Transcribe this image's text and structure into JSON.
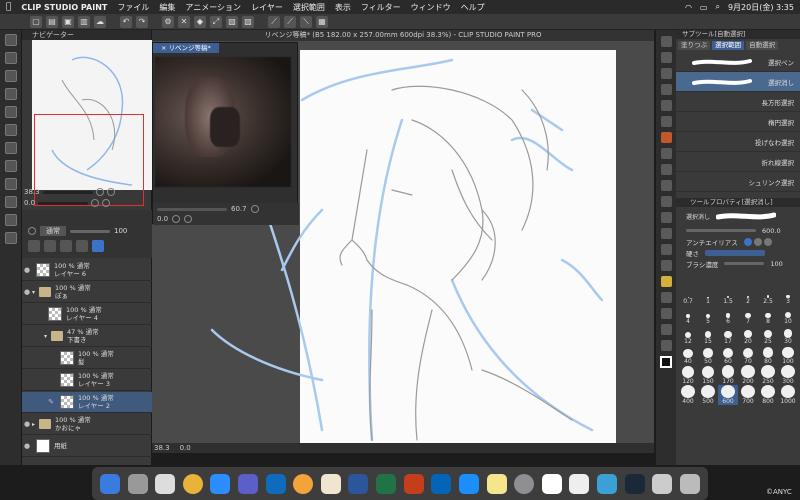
{
  "menubar": {
    "app_name": "CLIP STUDIO PAINT",
    "menus": [
      "ファイル",
      "編集",
      "アニメーション",
      "レイヤー",
      "選択範囲",
      "表示",
      "フィルター",
      "ウィンドウ",
      "ヘルプ"
    ],
    "clock": "9月20日(金) 3:35"
  },
  "window": {
    "title": "リベンジ等稿* (B5 182.00 x 257.00mm 600dpi 38.3%) - CLIP STUDIO PAINT PRO"
  },
  "navigator": {
    "title": "ナビゲーター",
    "zoom": "38.3",
    "angle": "0.0"
  },
  "layers": {
    "blend_mode": "通常",
    "opacity": "100",
    "items": [
      {
        "pct": "100 %",
        "mode": "通常",
        "name": "レイヤー 6",
        "folder": false
      },
      {
        "pct": "100 %",
        "mode": "通常",
        "name": "ぽぁ",
        "folder": true
      },
      {
        "pct": "100 %",
        "mode": "通常",
        "name": "レイヤー 4",
        "folder": false
      },
      {
        "pct": "47 %",
        "mode": "通常",
        "name": "下書き",
        "folder": true
      },
      {
        "pct": "100 %",
        "mode": "通常",
        "name": "髪",
        "folder": false
      },
      {
        "pct": "100 %",
        "mode": "通常",
        "name": "レイヤー 3",
        "folder": false
      },
      {
        "pct": "100 %",
        "mode": "通常",
        "name": "レイヤー 2",
        "folder": false
      },
      {
        "pct": "100 %",
        "mode": "通常",
        "name": "かおにゃ",
        "folder": true
      },
      {
        "pct": "",
        "mode": "",
        "name": "用紙",
        "folder": false
      }
    ]
  },
  "reference": {
    "tab": "リベンジ等稿*",
    "zoom": "60.7",
    "angle": "0.0"
  },
  "canvas": {
    "zoom": "38.3",
    "angle": "0.0"
  },
  "subtool": {
    "header": "サブツール[自動選択]",
    "tabs": [
      "塗りつぶ",
      "選択範囲",
      "自動選択"
    ],
    "items": [
      {
        "label": "選択ペン",
        "selected": false
      },
      {
        "label": "選択消し",
        "selected": true
      },
      {
        "label": "長方形選択",
        "selected": false
      },
      {
        "label": "楕円選択",
        "selected": false
      },
      {
        "label": "投げなわ選択",
        "selected": false
      },
      {
        "label": "折れ線選択",
        "selected": false
      },
      {
        "label": "シュリンク選択",
        "selected": false
      }
    ]
  },
  "properties": {
    "header": "ツールプロパティ[選択消し]",
    "tool_name": "選択消し",
    "brush_size": "600.0",
    "antialias_label": "アンチエイリアス",
    "hardness_label": "硬さ",
    "density_label": "ブラシ濃度",
    "density_value": "100"
  },
  "brush_sizes": [
    "0.7",
    "1",
    "1.5",
    "2",
    "2.5",
    "3",
    "4",
    "5",
    "6",
    "7",
    "8",
    "10",
    "12",
    "15",
    "17",
    "20",
    "25",
    "30",
    "40",
    "50",
    "60",
    "70",
    "80",
    "100",
    "120",
    "150",
    "170",
    "200",
    "250",
    "300",
    "400",
    "500",
    "600",
    "700",
    "800",
    "1000"
  ],
  "watermark": "©ANYC"
}
